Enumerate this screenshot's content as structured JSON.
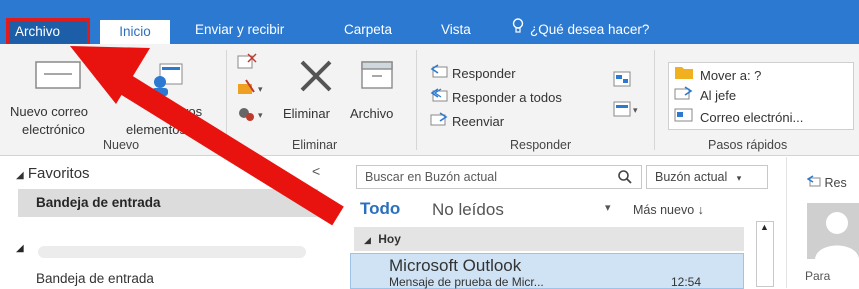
{
  "tabs": {
    "archivo": "Archivo",
    "inicio": "Inicio",
    "enviar": "Enviar y recibir",
    "carpeta": "Carpeta",
    "vista": "Vista",
    "search": "¿Qué desea hacer?"
  },
  "ribbon": {
    "nuevo": {
      "label": "Nuevo",
      "new_email_line1": "Nuevo correo",
      "new_email_line2": "electrónico",
      "new_items_line1": "Nuevos",
      "new_items_line2": "elementos"
    },
    "eliminar": {
      "label": "Eliminar",
      "delete_button": "Eliminar",
      "archive_button": "Archivo"
    },
    "responder": {
      "label": "Responder",
      "reply": "Responder",
      "reply_all": "Responder a todos",
      "forward": "Reenviar"
    },
    "pasos_rapidos": {
      "label": "Pasos rápidos",
      "move_to": "Mover a: ?",
      "to_manager": "Al jefe",
      "team_email": "Correo electróni..."
    }
  },
  "folder_pane": {
    "favorites_header": "Favoritos",
    "selected_folder": "Bandeja de entrada",
    "account_folder": "Bandeja de entrada",
    "collapse": "<"
  },
  "message_list": {
    "search_placeholder": "Buscar en Buzón actual",
    "search_scope": "Buzón actual",
    "filter_all": "Todo",
    "filter_unread": "No leídos",
    "sort": "Más nuevo ↓",
    "group_today": "Hoy",
    "messages": [
      {
        "sender": "Microsoft Outlook",
        "subject": "Mensaje de prueba de Micr...",
        "time": "12:54"
      }
    ]
  },
  "reading_pane": {
    "reply_label": "Res",
    "to_label": "Para"
  },
  "colors": {
    "accent": "#2b79d0",
    "highlight": "#e01b1b"
  }
}
